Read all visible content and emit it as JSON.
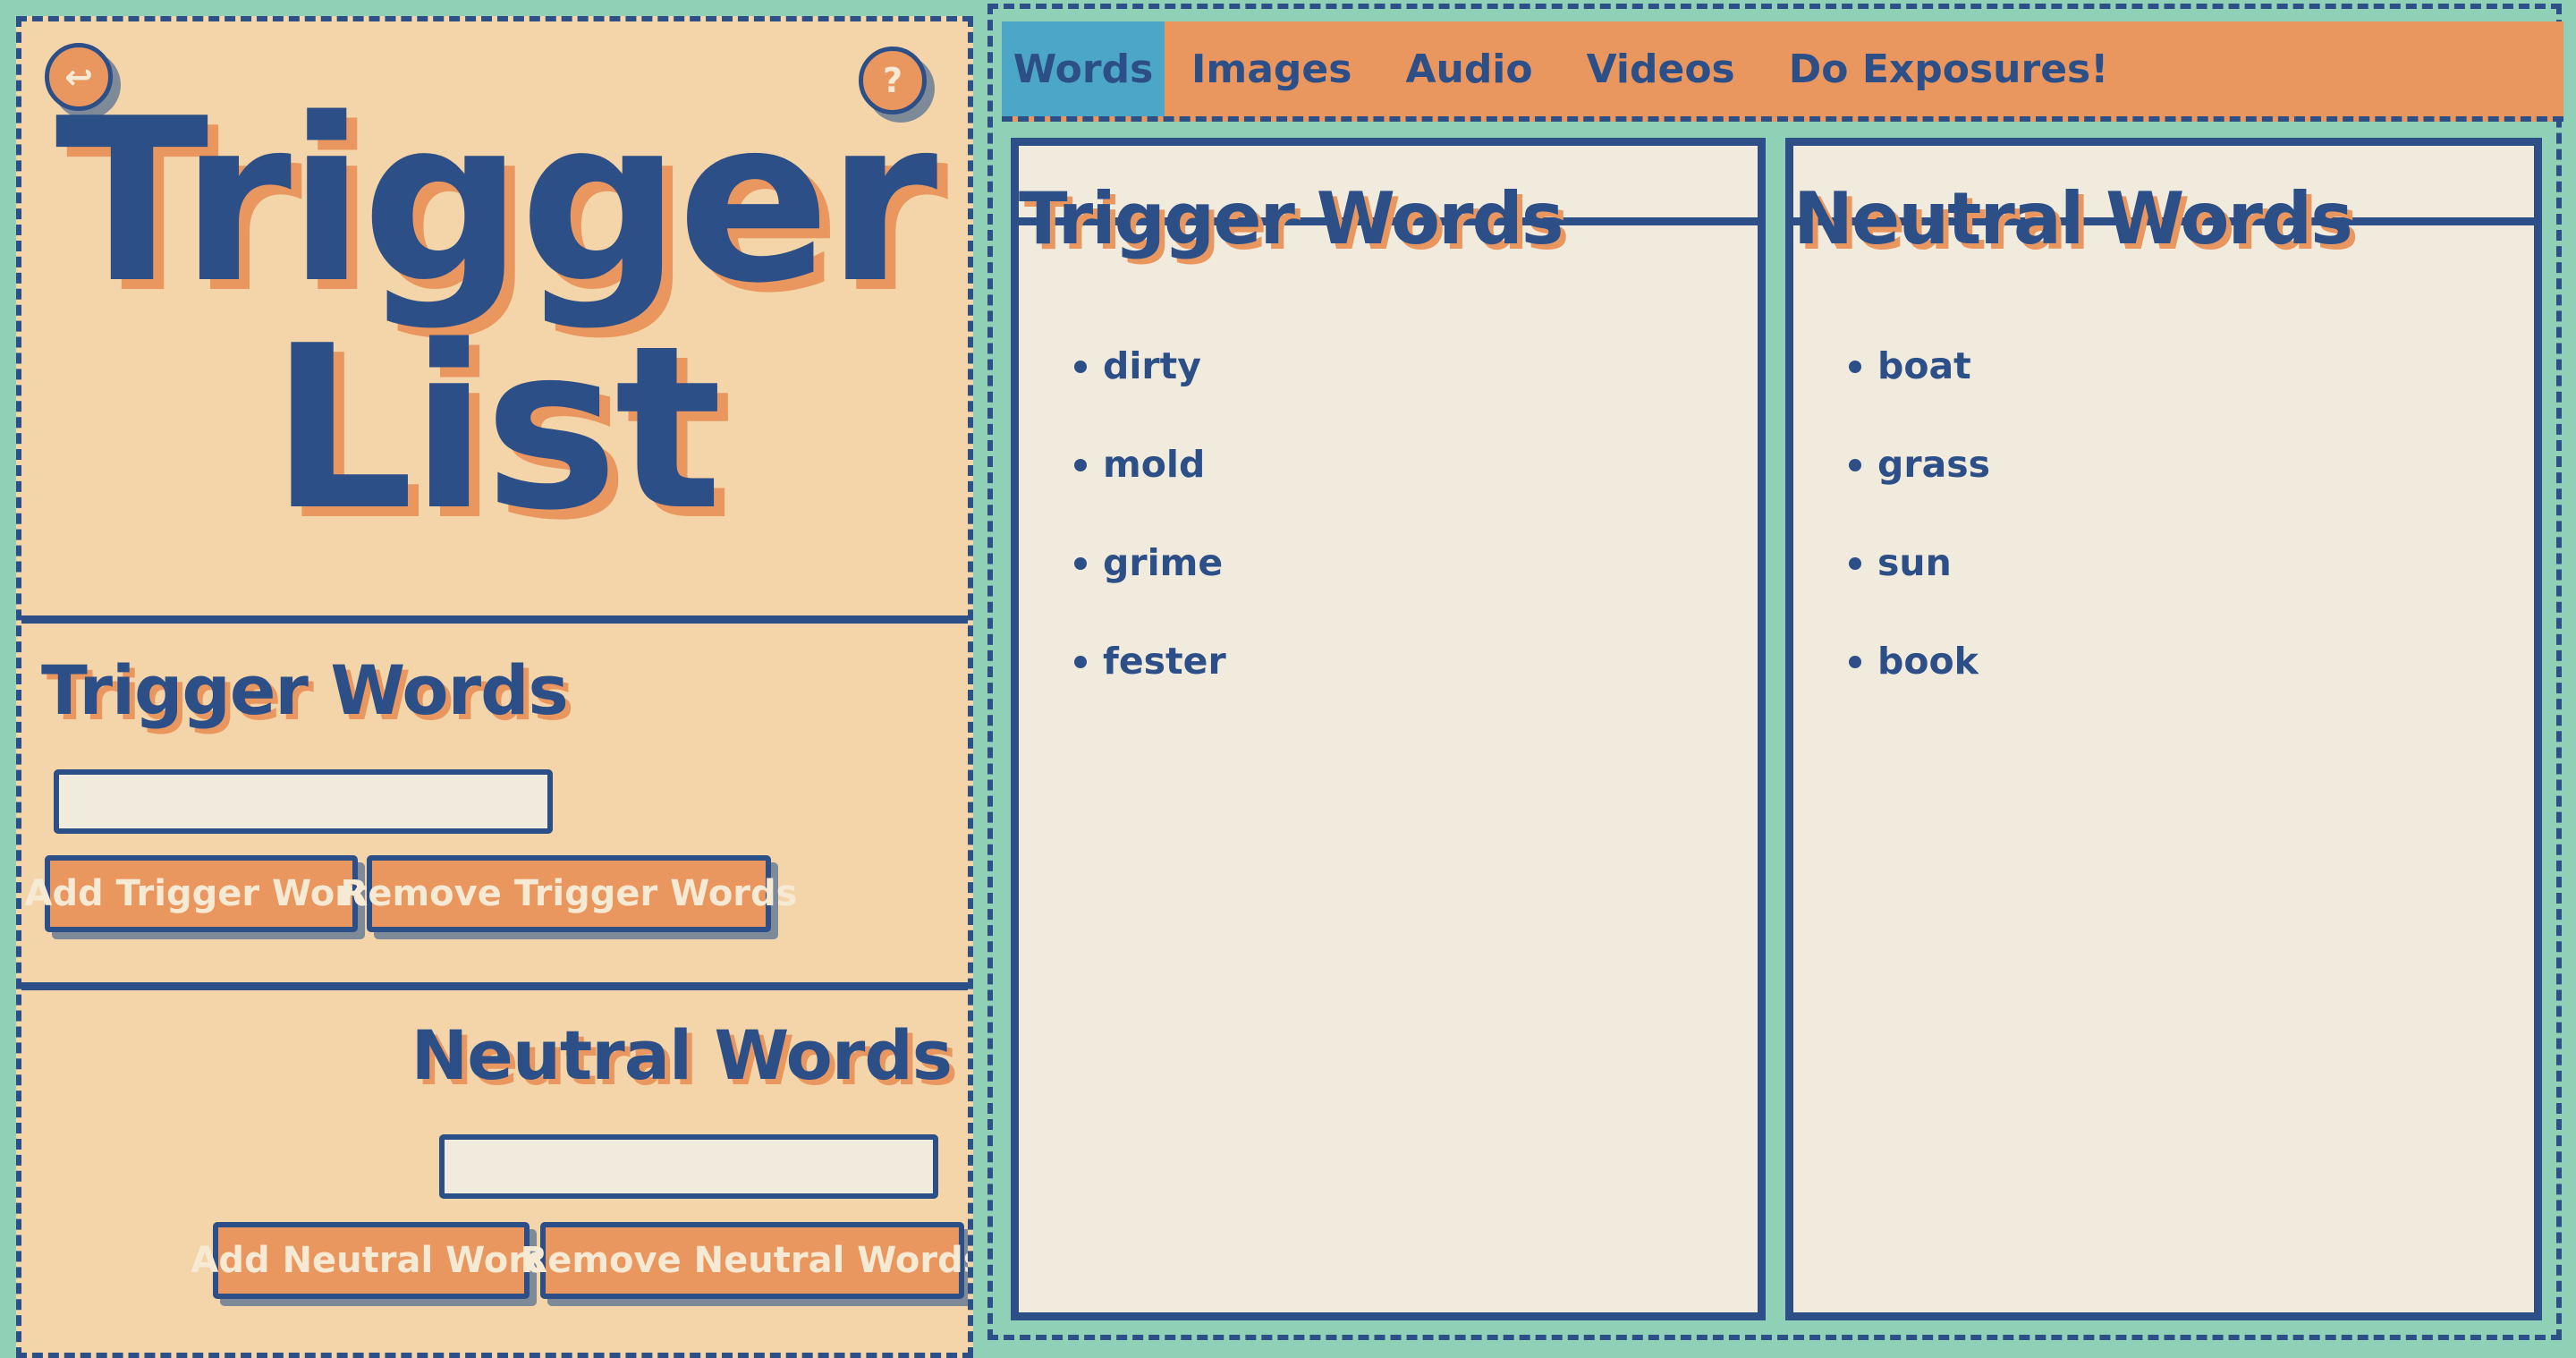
{
  "sidebar": {
    "back_icon": "↩",
    "help_icon": "?",
    "title_line1": "Trigger",
    "title_line2": "List",
    "trigger_section": {
      "heading": "Trigger Words",
      "input_value": "",
      "add_label": "Add Trigger Word",
      "remove_label": "Remove Trigger Words"
    },
    "neutral_section": {
      "heading": "Neutral Words",
      "input_value": "",
      "add_label": "Add Neutral Word",
      "remove_label": "Remove Neutral Words"
    }
  },
  "tabs": [
    {
      "label": "Words",
      "active": true
    },
    {
      "label": "Images",
      "active": false
    },
    {
      "label": "Audio",
      "active": false
    },
    {
      "label": "Videos",
      "active": false
    },
    {
      "label": "Do Exposures!",
      "active": false
    }
  ],
  "main": {
    "trigger_column": {
      "heading": "Trigger Words",
      "words": [
        "dirty",
        "mold",
        "grime",
        "fester"
      ]
    },
    "neutral_column": {
      "heading": "Neutral Words",
      "words": [
        "boat",
        "grass",
        "sun",
        "book"
      ]
    }
  },
  "colors": {
    "background": "#8fd0b6",
    "panel": "#f4d5a9",
    "navy": "#2d4f88",
    "orange": "#e9965f",
    "active_tab": "#4ba6c7",
    "list_bg": "#f1ebde"
  }
}
